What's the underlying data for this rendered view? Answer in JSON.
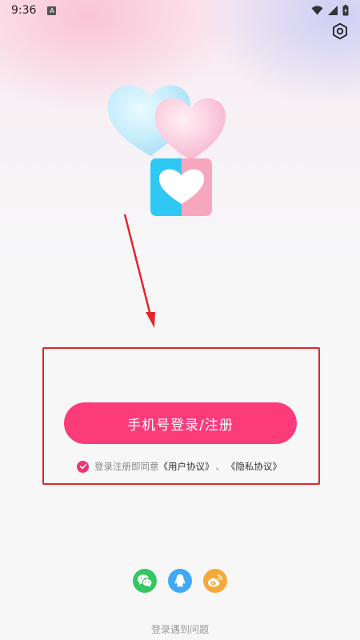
{
  "status_bar": {
    "time": "9:36",
    "notification_icon": "a-notification-icon",
    "wifi_icon": "wifi-icon",
    "signal_icon": "signal-icon",
    "battery_icon": "battery-icon"
  },
  "header": {
    "settings_icon": "settings-icon"
  },
  "logo": {
    "icon": "heart-app-logo",
    "balloon_icons": [
      "blue-heart-balloon",
      "pink-heart-balloon"
    ],
    "colors": {
      "blue": "#2fc8f5",
      "pink": "#f7a6c0"
    }
  },
  "login": {
    "phone_button_label": "手机号登录/注册",
    "button_color": "#fc3b7b"
  },
  "agreement": {
    "checked": true,
    "prefix": "登录注册即同意",
    "user_agreement": "《用户协议》",
    "separator": "、",
    "privacy_policy": "《隐私协议》"
  },
  "social_login": [
    {
      "name": "wechat",
      "icon": "wechat-icon",
      "color": "#34c760"
    },
    {
      "name": "qq",
      "icon": "qq-icon",
      "color": "#3fa9f5"
    },
    {
      "name": "weibo",
      "icon": "weibo-icon",
      "color": "#f6a93b"
    }
  ],
  "footer": {
    "help_text": "登录遇到问题"
  },
  "annotation": {
    "box_color": "#e0262b",
    "arrow_color": "#e0262b"
  }
}
